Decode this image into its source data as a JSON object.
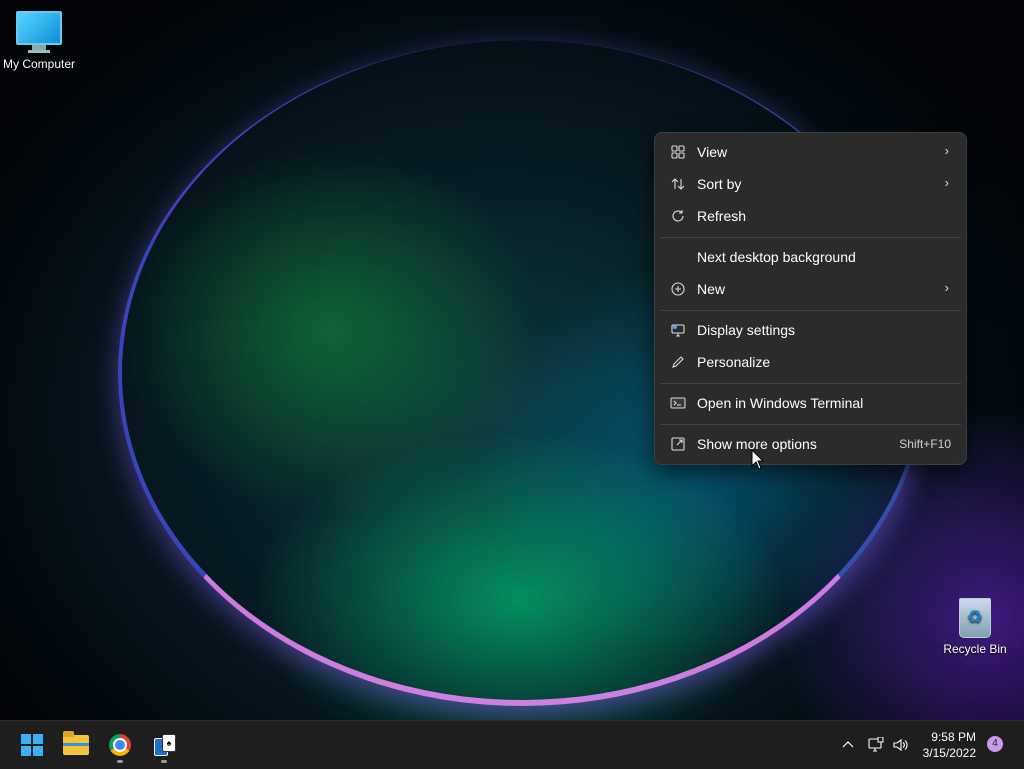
{
  "desktop": {
    "icons": [
      {
        "label": "My Computer",
        "icon": "computer-icon"
      },
      {
        "label": "Recycle Bin",
        "icon": "recycle-bin-icon"
      }
    ]
  },
  "context_menu": {
    "items": [
      {
        "label": "View",
        "icon": "grid-icon",
        "submenu": true
      },
      {
        "label": "Sort by",
        "icon": "sort-icon",
        "submenu": true
      },
      {
        "label": "Refresh",
        "icon": "refresh-icon"
      },
      {
        "label": "Next desktop background"
      },
      {
        "label": "New",
        "icon": "plus-circle-icon",
        "submenu": true
      },
      {
        "label": "Display settings",
        "icon": "display-settings-icon"
      },
      {
        "label": "Personalize",
        "icon": "pen-icon"
      },
      {
        "label": "Open in Windows Terminal",
        "icon": "terminal-icon"
      },
      {
        "label": "Show more options",
        "icon": "more-options-icon",
        "shortcut": "Shift+F10"
      }
    ]
  },
  "taskbar": {
    "apps": [
      {
        "name": "Start",
        "icon": "windows-start-icon"
      },
      {
        "name": "File Explorer",
        "icon": "file-explorer-icon"
      },
      {
        "name": "Google Chrome",
        "icon": "chrome-icon"
      },
      {
        "name": "Solitaire",
        "icon": "solitaire-icon"
      }
    ],
    "tray": {
      "time": "9:58 PM",
      "date": "3/15/2022",
      "notification_count": "4"
    }
  },
  "colors": {
    "menu_bg": "#2b2b2b",
    "taskbar_bg": "#1e1e1e",
    "accent": "#3ab0f5",
    "notification_badge": "#c79be8"
  }
}
